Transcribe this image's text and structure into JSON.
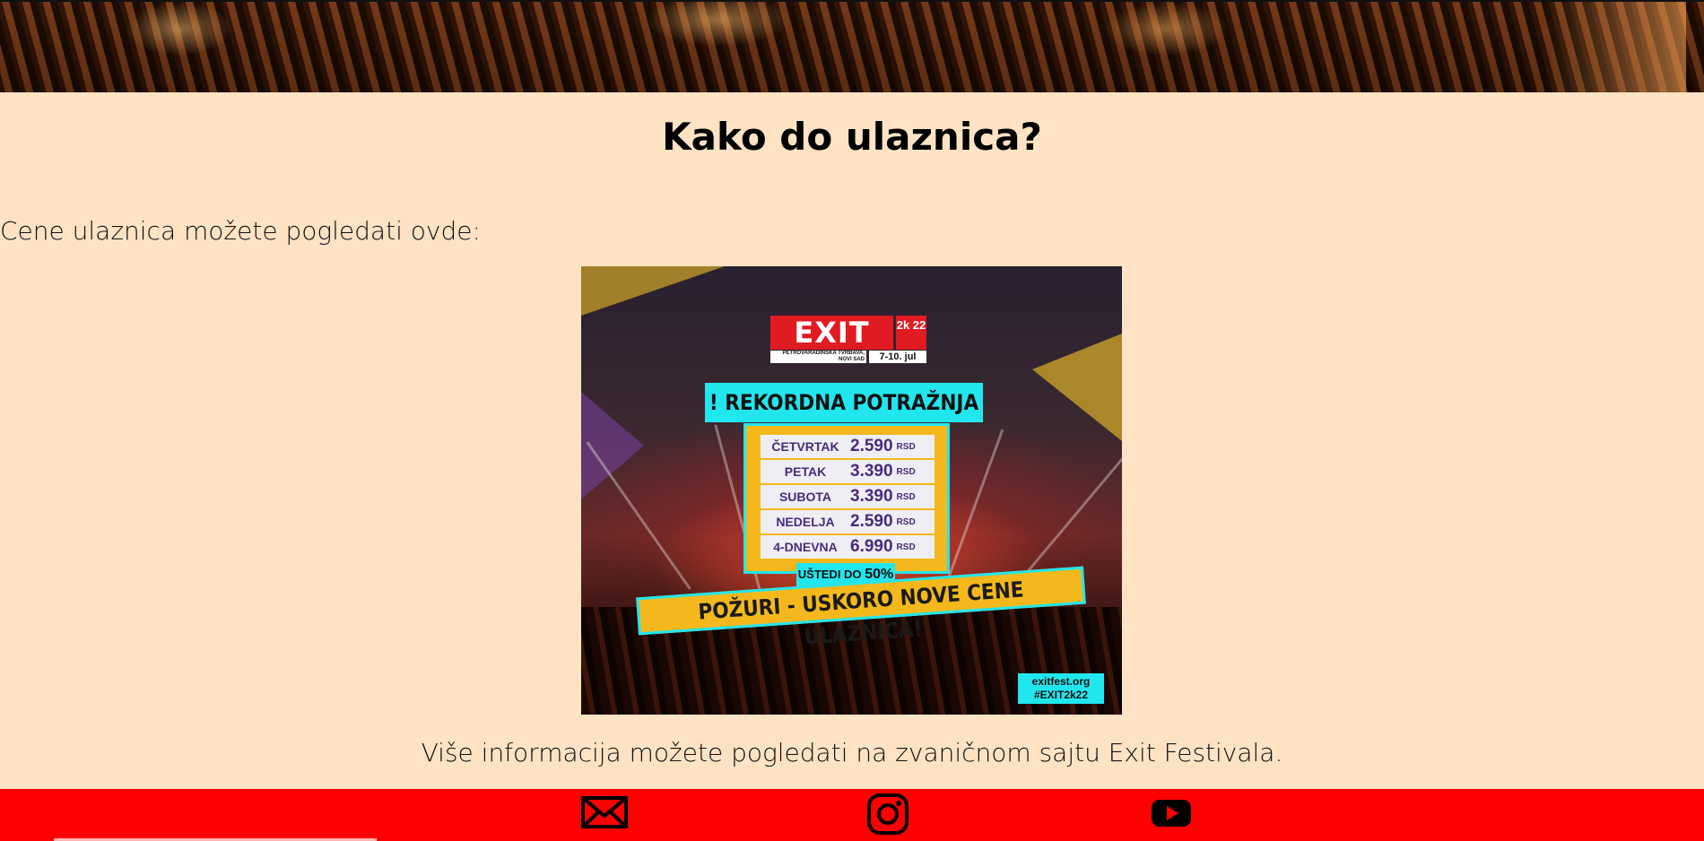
{
  "page": {
    "title": "Kako do ulaznica?",
    "intro_text": "Cene ulaznica možete pogledati ovde:",
    "more_info": "Više informacija možete pogledati na zvaničnom sajtu Exit Festivala."
  },
  "poster": {
    "logo_text": "EXIT",
    "logo_year": "2k 22",
    "logo_location": "PETROVARADINSKA TVRĐAVA, NOVI SAD",
    "logo_dates": "7-10. jul",
    "headline": "! REKORDNA POTRAŽNJA !",
    "prices": [
      {
        "day": "ČETVRTAK",
        "price": "2.590",
        "currency": "RSD"
      },
      {
        "day": "PETAK",
        "price": "3.390",
        "currency": "RSD"
      },
      {
        "day": "SUBOTA",
        "price": "3.390",
        "currency": "RSD"
      },
      {
        "day": "NEDELJA",
        "price": "2.590",
        "currency": "RSD"
      },
      {
        "day": "4-DNEVNA",
        "price": "6.990",
        "currency": "RSD"
      }
    ],
    "save_label": "UŠTEDI DO",
    "save_value": "50%",
    "hurry": "POŽURI - USKORO NOVE CENE ULAZNICA!",
    "site_line1": "exitfest.org",
    "site_line2": "#EXIT2k22"
  },
  "footer": {
    "icons": [
      "mail-icon",
      "instagram-icon",
      "youtube-icon"
    ],
    "background": "#ff0000"
  },
  "colors": {
    "page_bg": "#fde3c4",
    "accent_cyan": "#22e6ee",
    "accent_yellow": "#f4b81c",
    "exit_red": "#e11b22"
  }
}
